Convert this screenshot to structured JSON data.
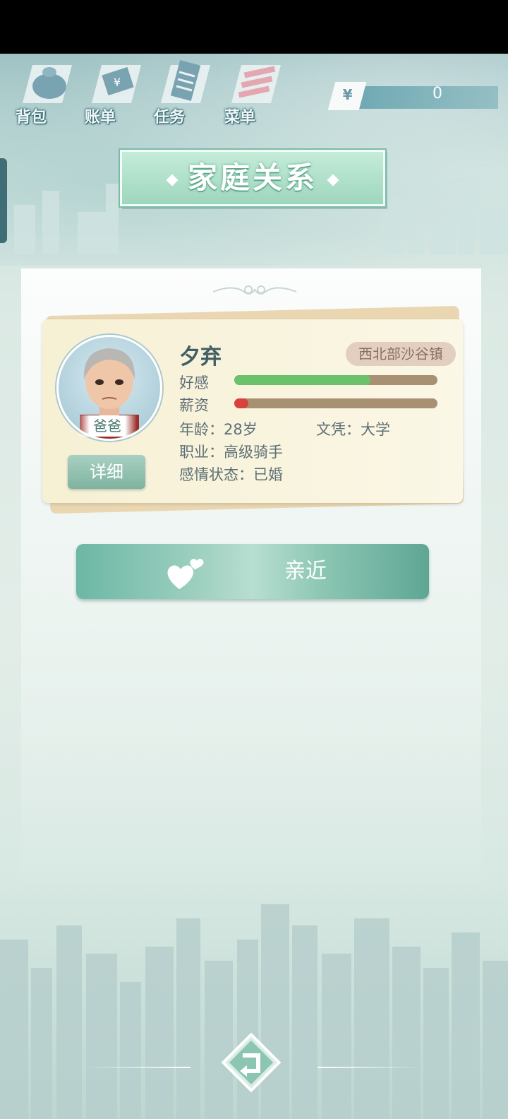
{
  "toolbar": {
    "items": [
      {
        "label": "背包",
        "icon": "bag-icon"
      },
      {
        "label": "账单",
        "icon": "bill-icon"
      },
      {
        "label": "任务",
        "icon": "task-icon"
      },
      {
        "label": "菜单",
        "icon": "menu-icon"
      }
    ]
  },
  "currency": {
    "symbol": "¥",
    "value": "0"
  },
  "page": {
    "title": "家庭关系"
  },
  "member": {
    "name": "夕弃",
    "relation": "爸爸",
    "location": "西北部沙谷镇",
    "favor_label": "好感",
    "favor_level": 0.67,
    "salary_label": "薪资",
    "salary_level": 0.07,
    "age": "年龄：28岁",
    "education": "文凭：大学",
    "job": "职业：高级骑手",
    "marital": "感情状态：已婚",
    "detail_label": "详细"
  },
  "actions": {
    "approach_label": "亲近"
  },
  "colors": {
    "favor": "#6cc26a",
    "salary": "#d9413d",
    "accent": "#8cc6b3"
  }
}
